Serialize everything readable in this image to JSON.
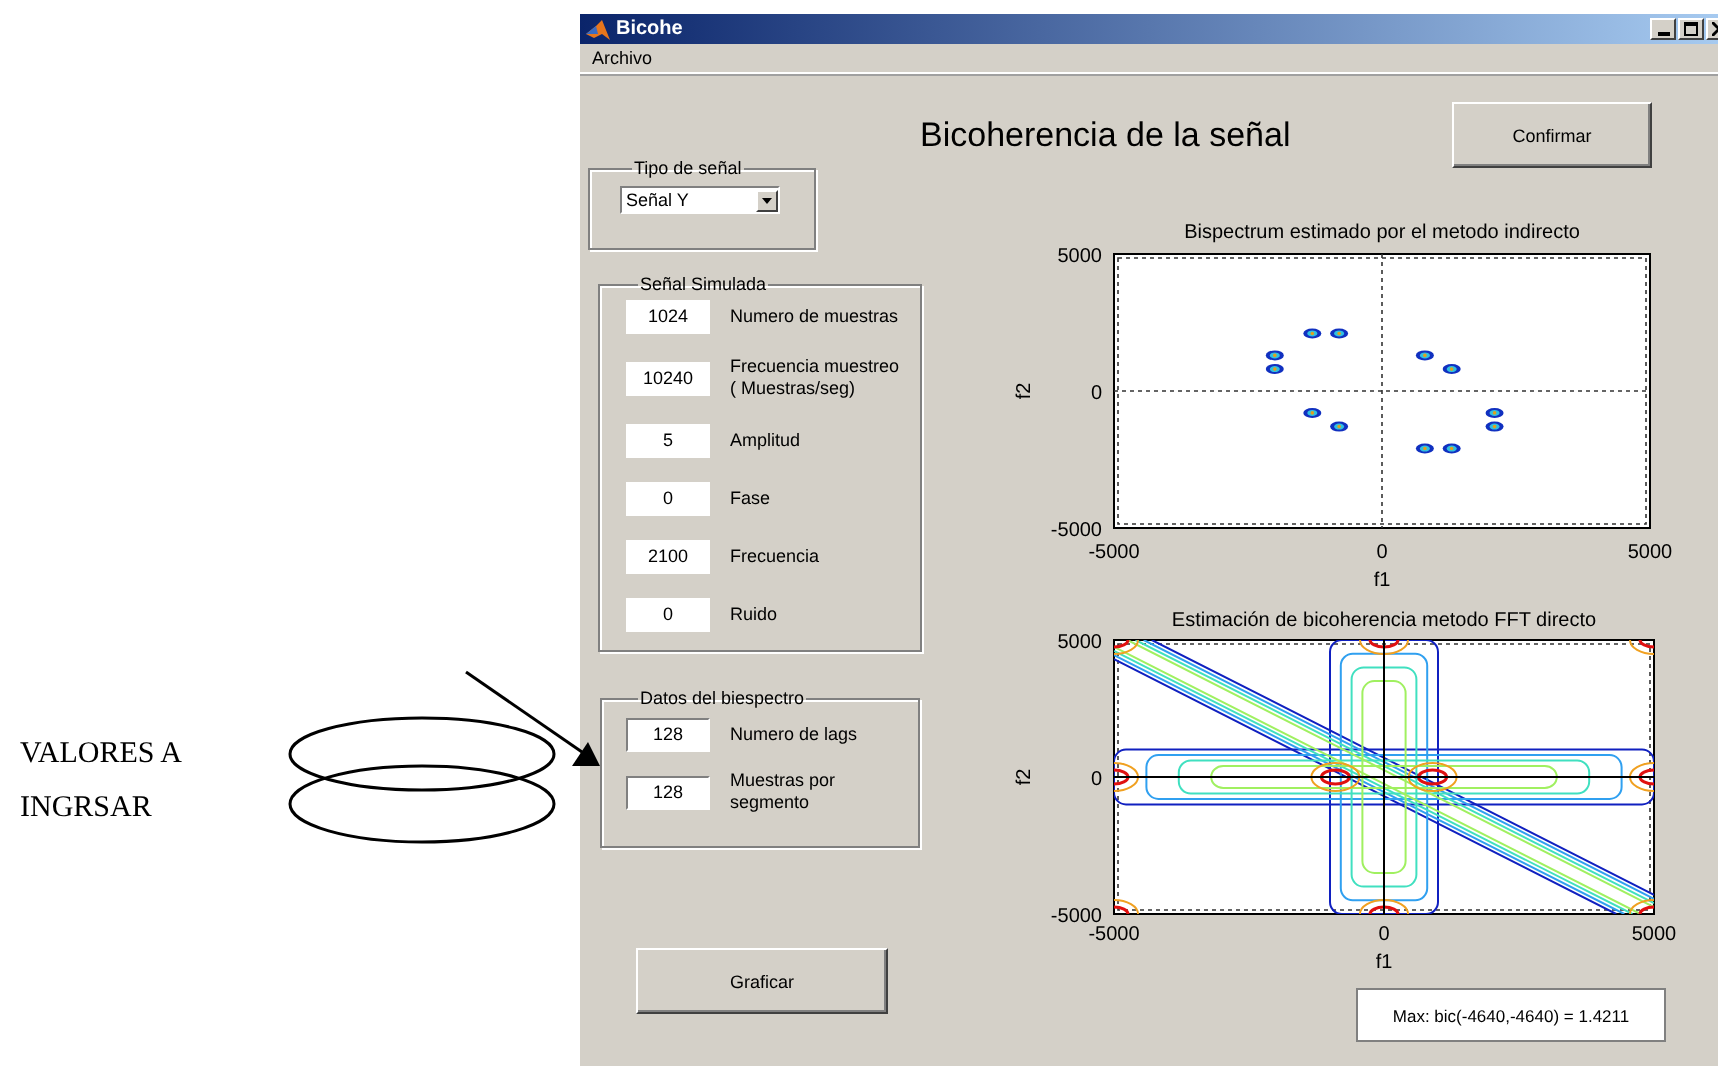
{
  "annotation": {
    "lines": [
      "VALORES A",
      "INGRSAR"
    ]
  },
  "window": {
    "title": "Bicohe",
    "menu": [
      "Archivo"
    ]
  },
  "heading": "Bicoherencia de la señal",
  "confirm_button": "Confirmar",
  "signal_type": {
    "title": "Tipo de señal",
    "value": "Señal Y"
  },
  "simulated_signal": {
    "title": "Señal Simulada",
    "fields": [
      {
        "value": "1024",
        "label": "Numero de muestras"
      },
      {
        "value": "10240",
        "label": "Frecuencia muestreo\n ( Muestras/seg)"
      },
      {
        "value": "5",
        "label": "Amplitud"
      },
      {
        "value": "0",
        "label": "Fase"
      },
      {
        "value": "2100",
        "label": "Frecuencia"
      },
      {
        "value": "0",
        "label": "Ruido"
      }
    ]
  },
  "bispectrum_data": {
    "title": "Datos del biespectro",
    "fields": [
      {
        "value": "128",
        "label": "Numero de lags"
      },
      {
        "value": "128",
        "label": "Muestras por\nsegmento"
      }
    ]
  },
  "plot_button": "Graficar",
  "plots": [
    {
      "kind": "blobs",
      "title": "Bispectrum estimado por el metodo indirecto",
      "xlabel": "f1",
      "ylabel": "f2",
      "xticks": [
        "-5000",
        "0",
        "5000"
      ],
      "yticks": [
        "5000",
        "0",
        "-5000"
      ]
    },
    {
      "kind": "contour",
      "title": "Estimación de bicoherencia metodo FFT directo",
      "xlabel": "f1",
      "ylabel": "f2",
      "xticks": [
        "-5000",
        "0",
        "5000"
      ],
      "yticks": [
        "5000",
        "0",
        "-5000"
      ]
    }
  ],
  "readout": "Max: bic(-4640,-4640) = 1.4211"
}
